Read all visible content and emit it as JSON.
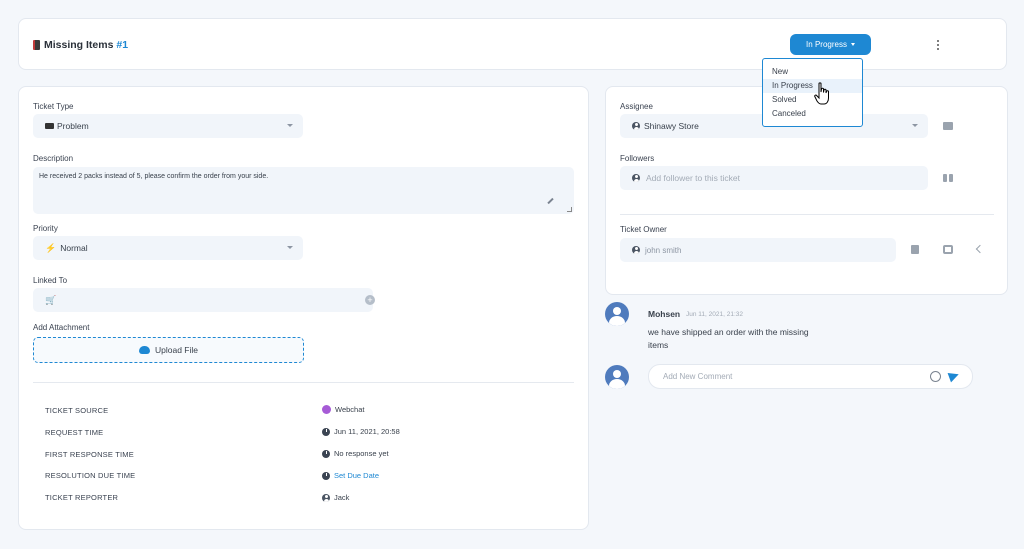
{
  "header": {
    "title": "Missing Items",
    "ticket_number": "#1",
    "status_button": "In Progress",
    "status_menu": [
      "New",
      "In Progress",
      "Solved",
      "Canceled"
    ]
  },
  "form": {
    "ticket_type_label": "Ticket Type",
    "ticket_type_value": "Problem",
    "description_label": "Description",
    "description_value": "He received 2 packs instead of 5, please confirm the order from your side.",
    "priority_label": "Priority",
    "priority_value": "Normal",
    "linked_to_label": "Linked To",
    "attachment_label": "Add Attachment",
    "upload_label": "Upload File"
  },
  "meta": [
    {
      "key": "TICKET SOURCE",
      "value": "Webchat",
      "icon": "webchat-icon"
    },
    {
      "key": "REQUEST TIME",
      "value": "Jun 11, 2021, 20:58",
      "icon": "clock-icon"
    },
    {
      "key": "FIRST RESPONSE TIME",
      "value": "No response yet",
      "icon": "clock-icon"
    },
    {
      "key": "RESOLUTION DUE TIME",
      "value": "Set Due Date",
      "icon": "clock-icon"
    },
    {
      "key": "TICKET REPORTER",
      "value": "Jack",
      "icon": "user-icon"
    }
  ],
  "assignment": {
    "assignee_label": "Assignee",
    "assignee_value": "Shinawy Store",
    "followers_label": "Followers",
    "followers_placeholder": "Add follower to this ticket",
    "owner_label": "Ticket Owner",
    "owner_value": "john smith"
  },
  "comments": [
    {
      "author": "Mohsen",
      "time": "Jun 11, 2021, 21:32",
      "text_line1": "we have shipped an order with the missing",
      "text_line2": "items"
    }
  ],
  "comment_input": {
    "placeholder": "Add New Comment"
  },
  "colors": {
    "accent": "#1e88d3",
    "link": "#1e88d3",
    "field_bg": "#f1f5fa"
  }
}
